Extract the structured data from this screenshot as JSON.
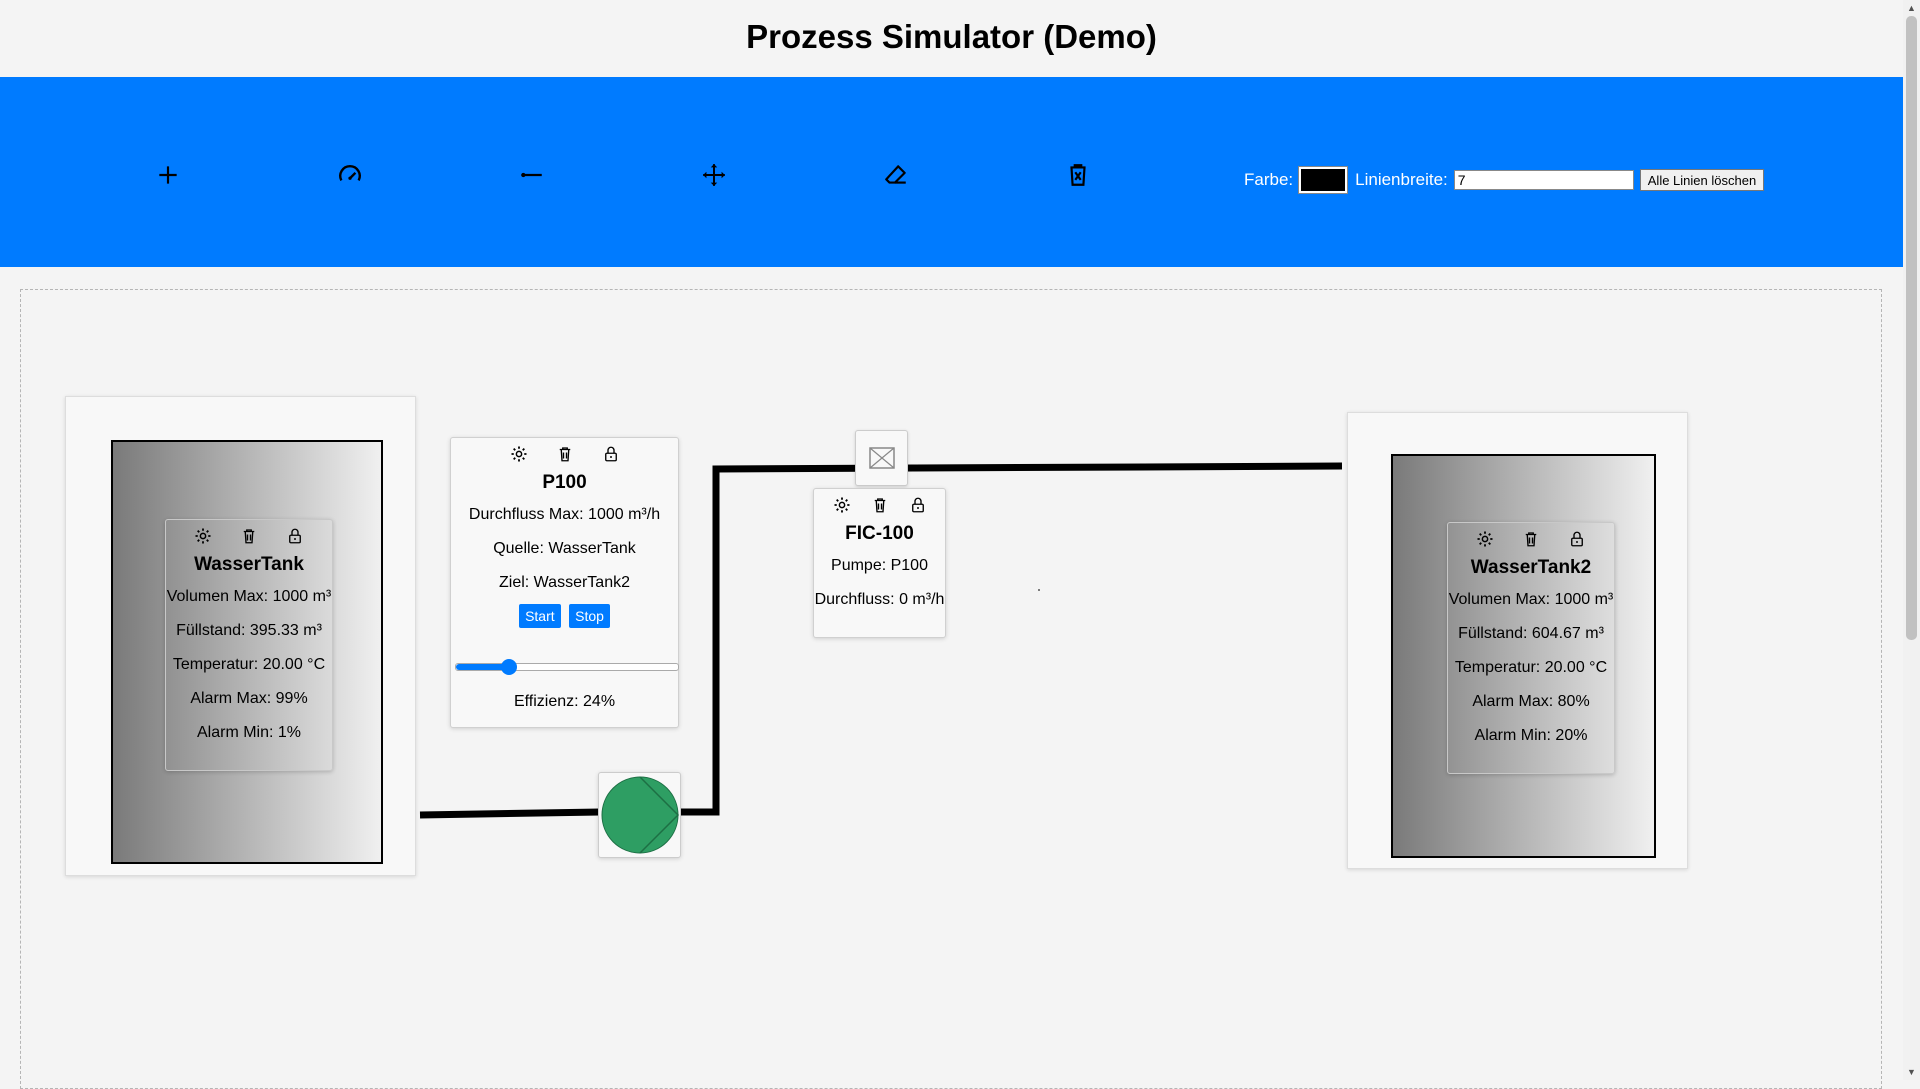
{
  "header": {
    "title": "Prozess Simulator (Demo)"
  },
  "toolbar": {
    "tools": [
      {
        "icon": "plus-icon"
      },
      {
        "icon": "gauge-icon"
      },
      {
        "icon": "line-draw-icon"
      },
      {
        "icon": "move-arrows-icon"
      },
      {
        "icon": "eraser-icon"
      },
      {
        "icon": "trash-x-icon"
      }
    ],
    "color_label": "Farbe:",
    "color_value": "#000000",
    "width_label": "Linienbreite:",
    "width_value": "7",
    "clear_label": "Alle Linien löschen",
    "bar_color": "#007bff"
  },
  "tanks": [
    {
      "name": "WasserTank",
      "volume_max": "Volumen Max: 1000 m³",
      "level": "Füllstand: 395.33 m³",
      "temperature": "Temperatur: 20.00 °C",
      "alarm_max": "Alarm Max: 99%",
      "alarm_min": "Alarm Min: 1%"
    },
    {
      "name": "WasserTank2",
      "volume_max": "Volumen Max: 1000 m³",
      "level": "Füllstand: 604.67 m³",
      "temperature": "Temperatur: 20.00 °C",
      "alarm_max": "Alarm Max: 80%",
      "alarm_min": "Alarm Min: 20%"
    }
  ],
  "pump": {
    "name": "P100",
    "flow_max": "Durchfluss Max: 1000 m³/h",
    "source": "Quelle: WasserTank",
    "target": "Ziel: WasserTank2",
    "start_label": "Start",
    "stop_label": "Stop",
    "efficiency": "Effizienz: 24%",
    "efficiency_value": 0.24,
    "pump_color": "#2e9e63"
  },
  "controller": {
    "name": "FIC-100",
    "pump": "Pumpe: P100",
    "flow": "Durchfluss: 0 m³/h"
  }
}
